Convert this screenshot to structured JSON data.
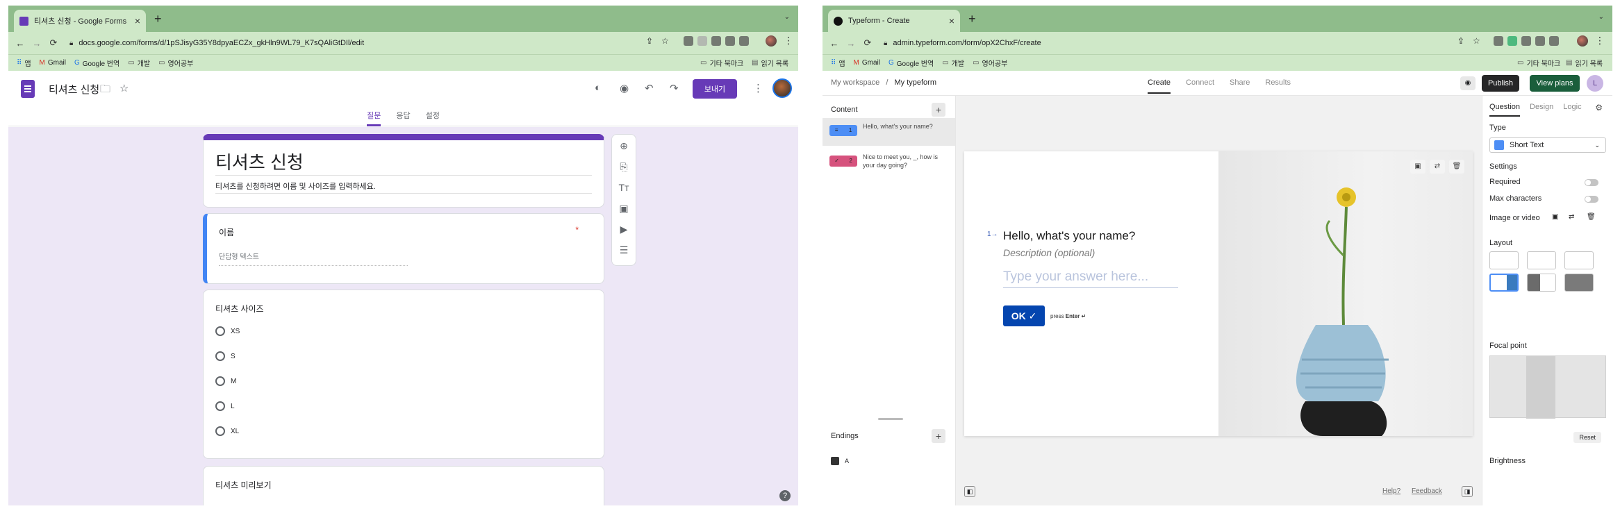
{
  "left_browser": {
    "tab_title": "티셔츠 신청 - Google Forms",
    "url": "docs.google.com/forms/d/1pSJisyG35Y8dpyaECZx_gkHln9WL79_K7sQAliGtDIl/edit",
    "bookmarks": [
      "앱",
      "Gmail",
      "Google 번역",
      "개발",
      "영어공부"
    ],
    "bookmarks_right": [
      "기타 북마크",
      "읽기 목록"
    ]
  },
  "gforms": {
    "doc_title": "티셔츠 신청",
    "send_label": "보내기",
    "tabs": [
      "질문",
      "응답",
      "설정"
    ],
    "form_title": "티셔츠 신청",
    "form_desc": "티셔츠를 신청하려면 이름 및 사이즈를 입력하세요.",
    "q1_title": "이름",
    "q1_required": "*",
    "q1_placeholder": "단답형 텍스트",
    "q2_title": "티셔츠 사이즈",
    "q2_options": [
      "XS",
      "S",
      "M",
      "L",
      "XL"
    ],
    "q3_title": "티셔츠 미리보기",
    "help": "?"
  },
  "right_browser": {
    "tab_title": "Typeform - Create",
    "url": "admin.typeform.com/form/opX2ChxF/create",
    "bookmarks": [
      "앱",
      "Gmail",
      "Google 번역",
      "개발",
      "영어공부"
    ],
    "bookmarks_right": [
      "기타 북마크",
      "읽기 목록"
    ]
  },
  "typeform": {
    "breadcrumb_workspace": "My workspace",
    "breadcrumb_sep": "/",
    "breadcrumb_form": "My typeform",
    "nav": [
      "Create",
      "Connect",
      "Share",
      "Results"
    ],
    "publish": "Publish",
    "view_plans": "View plans",
    "avatar": "L",
    "content_label": "Content",
    "questions": [
      {
        "num": "1",
        "text": "Hello, what's your name?",
        "color": "#4d8ef5"
      },
      {
        "num": "2",
        "text": "Nice to meet you, _, how is your day going?",
        "color": "#d6527d"
      }
    ],
    "endings_label": "Endings",
    "ending_badge": "A",
    "canvas": {
      "qnum": "1→",
      "question": "Hello, what's your name?",
      "description": "Description (optional)",
      "placeholder": "Type your answer here...",
      "ok": "OK ✓",
      "press": "press",
      "enter": "Enter ↵"
    },
    "footer_help": "Help?",
    "footer_feedback": "Feedback",
    "panel": {
      "tabs": [
        "Question",
        "Design",
        "Logic"
      ],
      "type_label": "Type",
      "type_value": "Short Text",
      "settings_label": "Settings",
      "required_label": "Required",
      "maxchars_label": "Max characters",
      "image_label": "Image or video",
      "layout_label": "Layout",
      "focal_label": "Focal point",
      "reset": "Reset",
      "brightness_label": "Brightness"
    }
  }
}
